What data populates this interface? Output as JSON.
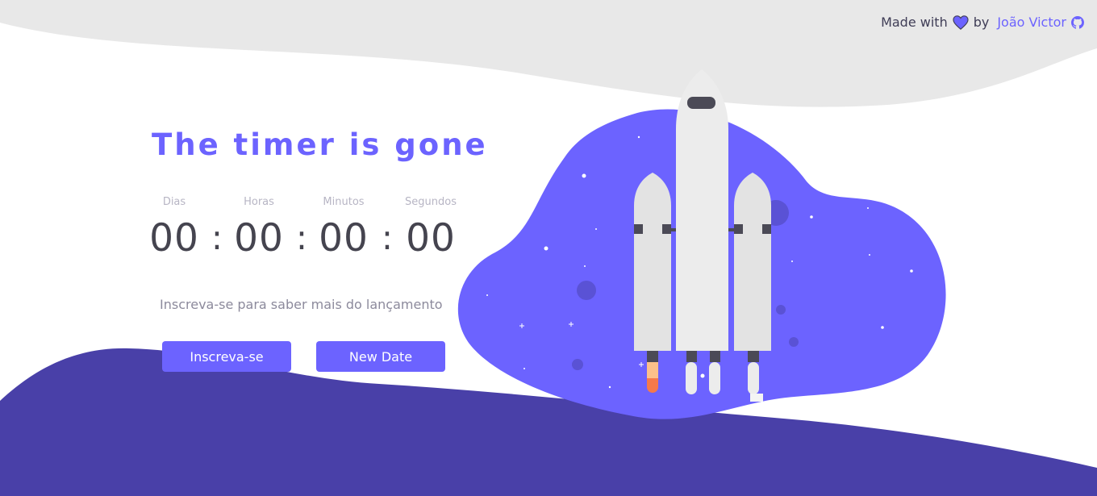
{
  "credit": {
    "made_with": "Made with",
    "by": "by",
    "author": "João Victor"
  },
  "header": {
    "title": "The timer is gone"
  },
  "timer": {
    "labels": [
      "Dias",
      "Horas",
      "Minutos",
      "Segundos"
    ],
    "values": [
      "00",
      "00",
      "00",
      "00"
    ],
    "separator": ":"
  },
  "subscribe": {
    "text": "Inscreva-se para saber mais do lançamento",
    "subscribe_button": "Inscreva-se",
    "new_date_button": "New Date"
  },
  "colors": {
    "accent": "#6c63ff",
    "deep_wave": "#4940a8",
    "light_wave": "#e8e8e8",
    "text_dark": "#45444f"
  },
  "icons": [
    "heart-icon",
    "github-icon",
    "rocket-illustration"
  ]
}
